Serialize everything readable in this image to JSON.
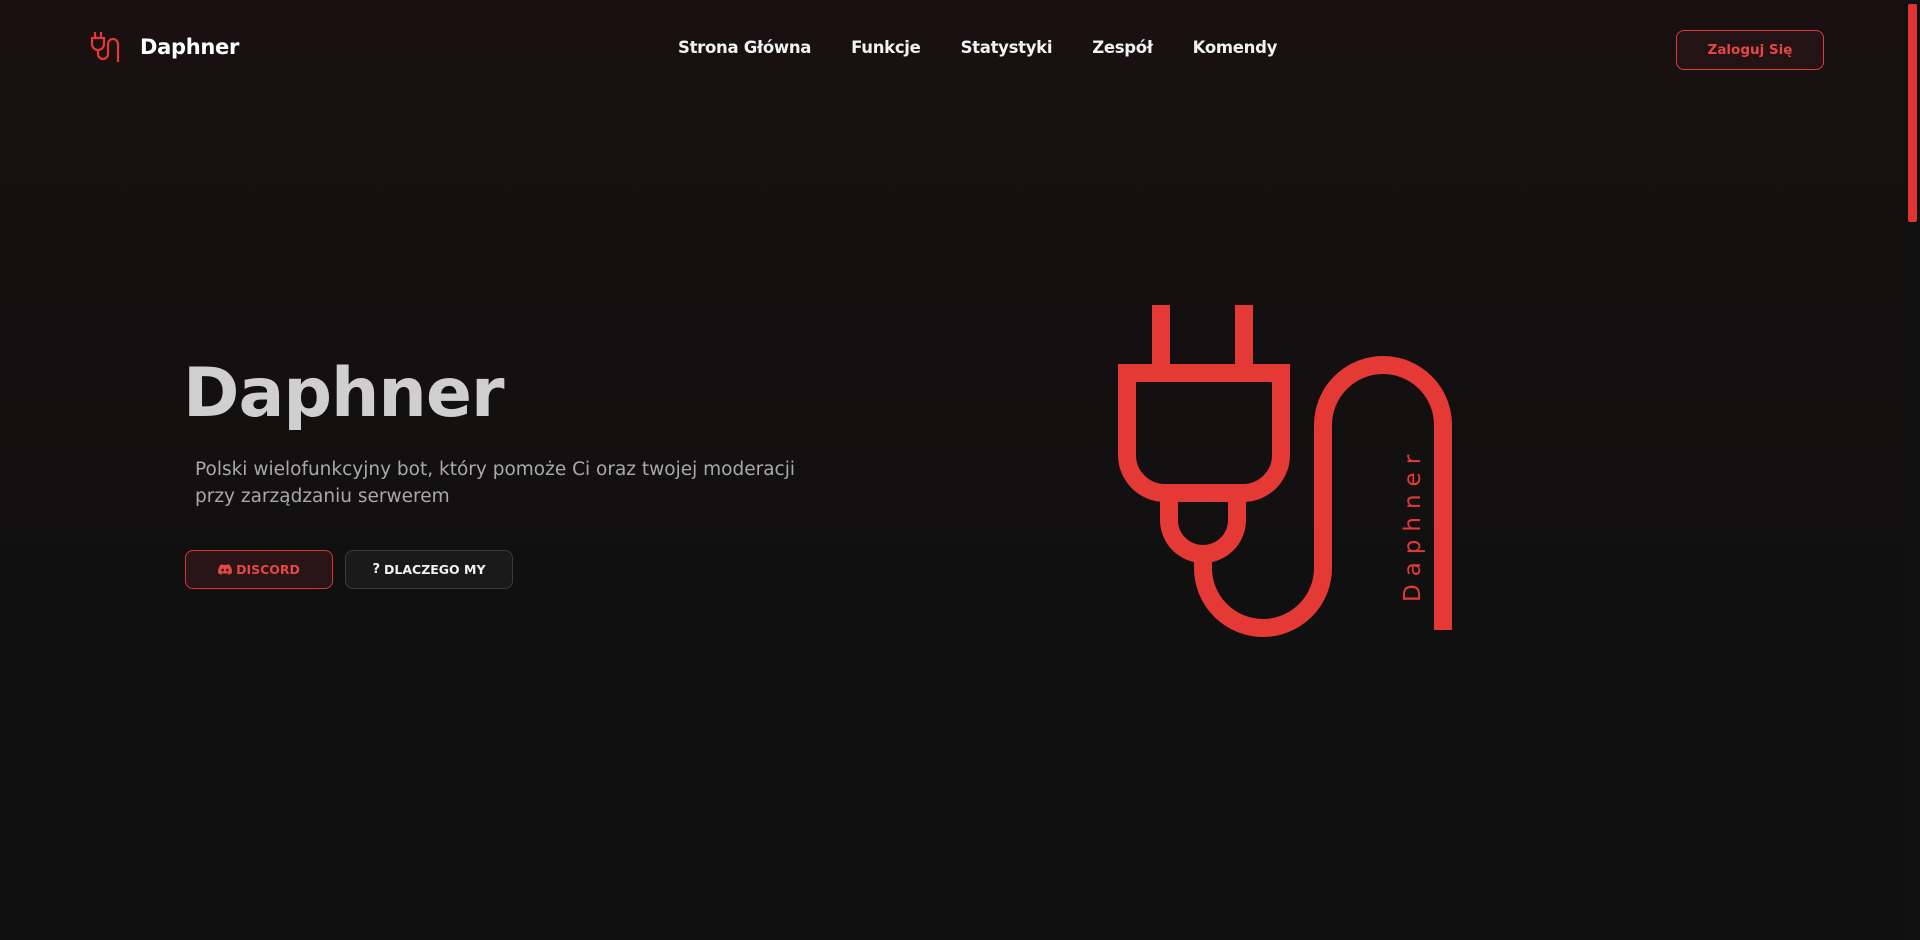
{
  "brand": {
    "name": "Daphner",
    "icon": "plug-icon",
    "accent_color": "#e53935"
  },
  "nav": {
    "links": [
      "Strona Główna",
      "Funkcje",
      "Statystyki",
      "Zespół",
      "Komendy"
    ],
    "login_label": "Zaloguj Się"
  },
  "hero": {
    "title": "Daphner",
    "description": "Polski wielofunkcyjny bot, który pomoże Ci oraz twojej moderacji przy zarządzaniu serwerem",
    "buttons": {
      "discord": {
        "label": "DISCORD",
        "icon": "discord-icon"
      },
      "why": {
        "label": "DLACZEGO MY",
        "icon": "question-icon"
      }
    },
    "logo_text": "Daphner",
    "logo_icon": "plug-cable-icon"
  },
  "colors": {
    "accent": "#e53935",
    "background": "#0f0f0f"
  }
}
